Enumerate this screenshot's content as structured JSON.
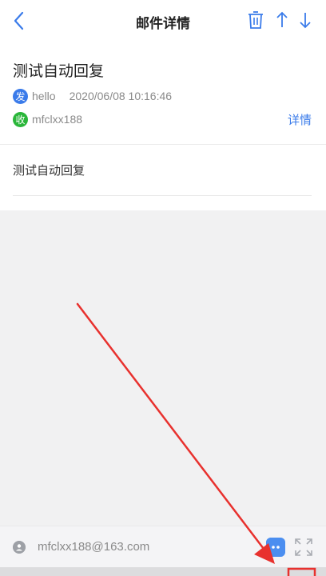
{
  "header": {
    "title": "邮件详情",
    "icons": [
      "back-icon",
      "trash-icon",
      "arrow-up-icon",
      "arrow-down-icon"
    ]
  },
  "mail": {
    "subject": "测试自动回复",
    "from_badge": "发",
    "from_name": "hello",
    "date": "2020/06/08 10:16:46",
    "to_badge": "收",
    "to_name": "mfclxx188",
    "detail_link": "详情",
    "body": "测试自动回复"
  },
  "bottom_bar": {
    "address": "mfclxx188@163.com",
    "icons": [
      "avatar-icon",
      "chat-icon",
      "expand-icon"
    ]
  },
  "colors": {
    "accent": "#3a7bea",
    "to_badge": "#2ab63a",
    "annotation_arrow": "#e8312e"
  }
}
